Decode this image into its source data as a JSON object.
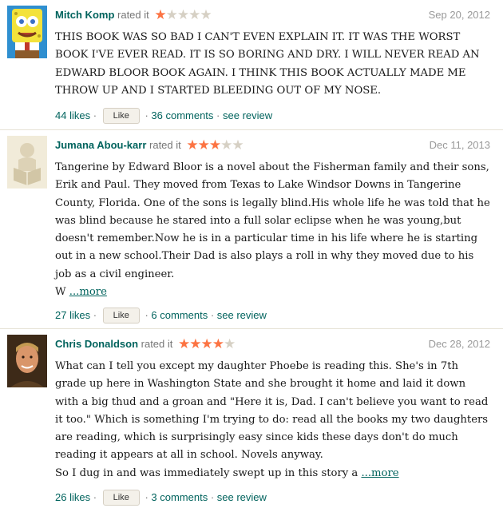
{
  "reviews": [
    {
      "name": "Mitch Komp",
      "rated": "rated it",
      "rating": 1,
      "date": "Sep 20, 2012",
      "text": "THIS BOOK WAS SO BAD I CAN'T EVEN EXPLAIN IT. IT WAS THE WORST BOOK I'VE EVER READ. IT IS SO BORING AND DRY. I WILL NEVER READ AN EDWARD BLOOR BOOK AGAIN. I THINK THIS BOOK ACTUALLY MADE ME THROW UP AND I STARTED BLEEDING OUT OF MY NOSE.",
      "more": "",
      "likes": "44 likes",
      "like_btn": "Like",
      "comments": "36 comments",
      "see_review": "see review",
      "avatar_icon": "cartoon-avatar"
    },
    {
      "name": "Jumana Abou-karr",
      "rated": "rated it",
      "rating": 3,
      "date": "Dec 11, 2013",
      "text": "Tangerine by Edward Bloor is a novel about the Fisherman family and their sons, Erik and Paul. They moved from Texas to Lake Windsor Downs in Tangerine County, Florida. One of the sons is legally blind.His whole life he was told that he was blind because he stared into a full solar eclipse when he was young,but doesn't remember.Now he is in a particular time in his life where he is starting out in a new school.Their Dad is also plays a roll in why they moved due to his job as a civil engineer.\nW",
      "more": "...more",
      "likes": "27 likes",
      "like_btn": "Like",
      "comments": "6 comments",
      "see_review": "see review",
      "avatar_icon": "default-reader-icon"
    },
    {
      "name": "Chris Donaldson",
      "rated": "rated it",
      "rating": 4,
      "date": "Dec 28, 2012",
      "text": "What can I tell you except my daughter Phoebe is reading this. She's in 7th grade up here in Washington State and she brought it home and laid it down with a big thud and a groan and \"Here it is, Dad. I can't believe you want to read it too.\" Which is something I'm trying to do: read all the books my two daughters are reading, which is surprisingly easy since kids these days don't do much reading it appears at all in school. Novels anyway.\nSo I dug in and was immediately swept up in this story a",
      "more": "...more",
      "likes": "26 likes",
      "like_btn": "Like",
      "comments": "3 comments",
      "see_review": "see review",
      "avatar_icon": "photo-avatar"
    }
  ],
  "separator": " · "
}
